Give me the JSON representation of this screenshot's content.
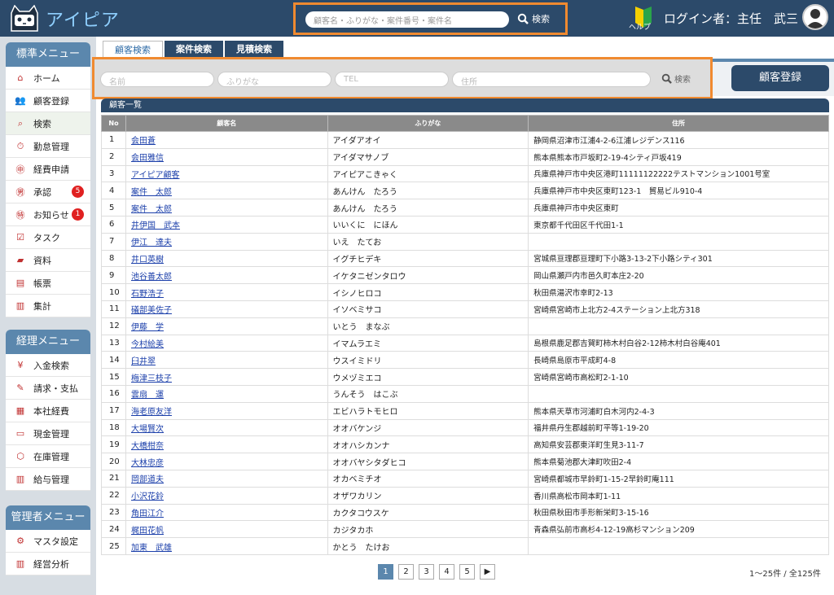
{
  "header": {
    "app_name": "アイピア",
    "search_placeholder": "顧客名・ふりがな・案件番号・案件名",
    "search_label": "検索",
    "help_label": "ヘルプ",
    "login_text": "ログイン者：主任　武三"
  },
  "sidebar": {
    "standard_title": "標準メニュー",
    "standard_items": [
      {
        "label": "ホーム",
        "icon": "home-icon"
      },
      {
        "label": "顧客登録",
        "icon": "people-icon"
      },
      {
        "label": "検索",
        "icon": "magnifier-icon"
      },
      {
        "label": "勤怠管理",
        "icon": "clock-icon"
      },
      {
        "label": "経費申請",
        "icon": "expense-icon"
      },
      {
        "label": "承認",
        "icon": "approve-icon",
        "badge": "5"
      },
      {
        "label": "お知らせ",
        "icon": "notice-icon",
        "badge": "1"
      },
      {
        "label": "タスク",
        "icon": "task-icon"
      },
      {
        "label": "資料",
        "icon": "folder-icon"
      },
      {
        "label": "帳票",
        "icon": "document-icon"
      },
      {
        "label": "集計",
        "icon": "bar-chart-icon"
      }
    ],
    "accounting_title": "経理メニュー",
    "accounting_items": [
      {
        "label": "入金検索",
        "icon": "deposit-icon"
      },
      {
        "label": "請求・支払",
        "icon": "invoice-icon"
      },
      {
        "label": "本社経費",
        "icon": "hq-expense-icon"
      },
      {
        "label": "現金管理",
        "icon": "cash-icon"
      },
      {
        "label": "在庫管理",
        "icon": "box-icon"
      },
      {
        "label": "給与管理",
        "icon": "salary-icon"
      }
    ],
    "admin_title": "管理者メニュー",
    "admin_items": [
      {
        "label": "マスタ設定",
        "icon": "gear-icon"
      },
      {
        "label": "経営分析",
        "icon": "analysis-icon"
      }
    ]
  },
  "tabs": [
    "顧客検索",
    "案件検索",
    "見積検索"
  ],
  "search": {
    "name_placeholder": "名前",
    "kana_placeholder": "ふりがな",
    "tel_placeholder": "TEL",
    "address_placeholder": "住所",
    "search_label": "検索",
    "register_button": "顧客登録"
  },
  "list": {
    "title": "顧客一覧",
    "columns": [
      "No",
      "顧客名",
      "ふりがな",
      "住所"
    ],
    "rows": [
      [
        "1",
        "会田蒼",
        "アイダアオイ",
        "静岡県沼津市江浦4-2-6江浦レジデンス116"
      ],
      [
        "2",
        "会田雅信",
        "アイダマサノブ",
        "熊本県熊本市戸坂町2-19-4シティ戸坂419"
      ],
      [
        "3",
        "アイピア顧客",
        "アイピアこきゃく",
        "兵庫県神戸市中央区港町11111122222テストマンション1001号室"
      ],
      [
        "4",
        "案件　太郎",
        "あんけん　たろう",
        "兵庫県神戸市中央区東町123-1　貿易ビル910-4"
      ],
      [
        "5",
        "案件　太郎",
        "あんけん　たろう",
        "兵庫県神戸市中央区東町"
      ],
      [
        "6",
        "井伊国　武本",
        "いいくに　にほん",
        "東京都千代田区千代田1-1"
      ],
      [
        "7",
        "伊江　達夫",
        "いえ　たてお",
        ""
      ],
      [
        "8",
        "井口英樹",
        "イグチヒデキ",
        "宮城県亘理郡亘理町下小路3-13-2下小路シティ301"
      ],
      [
        "9",
        "池谷善太郎",
        "イケタニゼンタロウ",
        "岡山県瀬戸内市邑久町本庄2-20"
      ],
      [
        "10",
        "石野浩子",
        "イシノヒロコ",
        "秋田県湯沢市幸町2-13"
      ],
      [
        "11",
        "礒部美佐子",
        "イソベミサコ",
        "宮崎県宮崎市上北方2-4ステーション上北方318"
      ],
      [
        "12",
        "伊藤　学",
        "いとう　まなぶ",
        ""
      ],
      [
        "13",
        "今村絵美",
        "イマムラエミ",
        "島根県鹿足郡吉賀町柿木村白谷2-12柿木村白谷庵401"
      ],
      [
        "14",
        "臼井翠",
        "ウスイミドリ",
        "長崎県島原市平成町4-8"
      ],
      [
        "15",
        "梅津三枝子",
        "ウメヅミエコ",
        "宮崎県宮崎市高松町2-1-10"
      ],
      [
        "16",
        "雲扇　運",
        "うんそう　はこぶ",
        ""
      ],
      [
        "17",
        "海老原友洋",
        "エビハラトモヒロ",
        "熊本県天草市河浦町白木河内2-4-3"
      ],
      [
        "18",
        "大場賢次",
        "オオバケンジ",
        "福井県丹生郡越前町平等1-19-20"
      ],
      [
        "19",
        "大橋柑奈",
        "オオハシカンナ",
        "高知県安芸郡東洋町生見3-11-7"
      ],
      [
        "20",
        "大林忠彦",
        "オオバヤシタダヒコ",
        "熊本県菊池郡大津町吹田2-4"
      ],
      [
        "21",
        "岡部道夫",
        "オカベミチオ",
        "宮崎県都城市早鈴町1-15-2早鈴町庵111"
      ],
      [
        "22",
        "小沢花鈴",
        "オザワカリン",
        "香川県高松市岡本町1-11"
      ],
      [
        "23",
        "角田江介",
        "カクタコウスケ",
        "秋田県秋田市手形新栄町3-15-16"
      ],
      [
        "24",
        "梶田花帆",
        "カジタカホ",
        "青森県弘前市高杉4-12-19高杉マンション209"
      ],
      [
        "25",
        "加東　武雄",
        "かとう　たけお",
        ""
      ]
    ]
  },
  "pagination": {
    "pages": [
      "1",
      "2",
      "3",
      "4",
      "5"
    ],
    "next": "▶",
    "count_text": "1～25件 / 全125件"
  }
}
